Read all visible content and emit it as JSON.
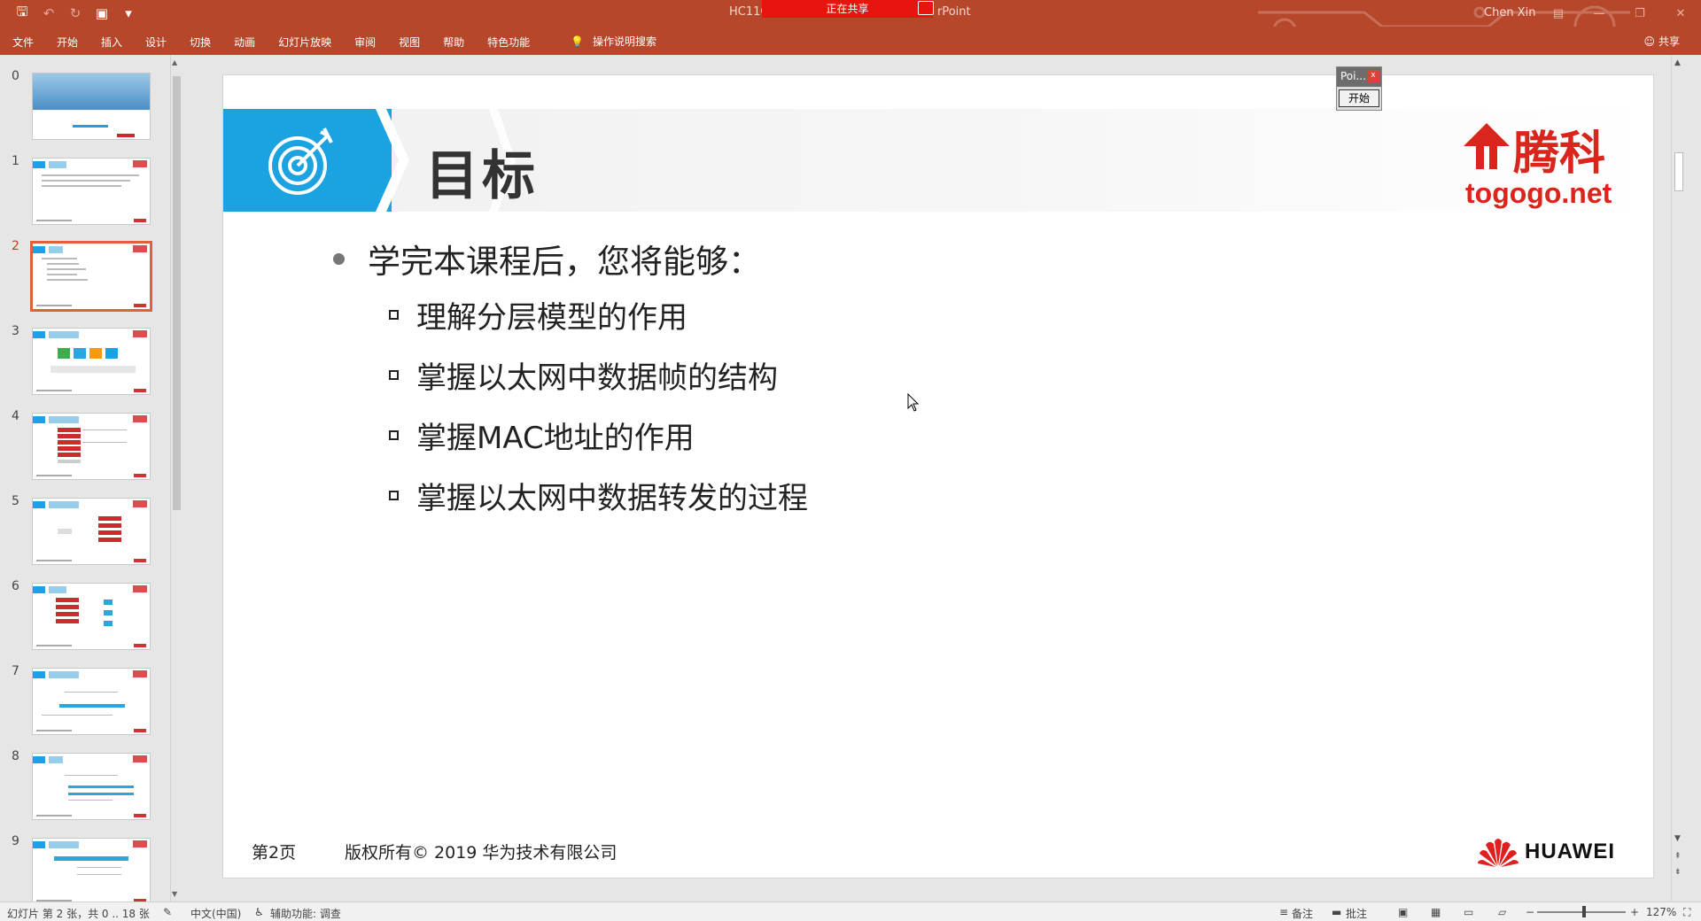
{
  "window": {
    "title_left": "HC11C",
    "title_right": "rPoint",
    "share_banner": "正在共享",
    "user": "Chen Xin"
  },
  "ribbon": {
    "tabs": [
      "文件",
      "开始",
      "插入",
      "设计",
      "切换",
      "动画",
      "幻灯片放映",
      "审阅",
      "视图",
      "帮助",
      "特色功能"
    ],
    "tell_me": "操作说明搜索",
    "share": "共享"
  },
  "thumbnails": {
    "numbers": [
      "0",
      "1",
      "2",
      "3",
      "4",
      "5",
      "6",
      "7",
      "8",
      "9"
    ],
    "active_index": 2
  },
  "slide": {
    "title": "目标",
    "logo_brand": "腾科",
    "logo_url": "togogo.net",
    "bullet": "学完本课程后，您将能够：",
    "sub_bullets": [
      "理解分层模型的作用",
      "掌握以太网中数据帧的结构",
      "掌握MAC地址的作用",
      "掌握以太网中数据转发的过程"
    ],
    "footer_page": "第2页",
    "footer_copyright": "版权所有© 2019 华为技术有限公司",
    "huawei": "HUAWEI"
  },
  "pointer_window": {
    "title": "Poi...",
    "close": "x",
    "start": "开始"
  },
  "statusbar": {
    "slide_info": "幻灯片 第 2 张，共 0 .. 18 张",
    "language": "中文(中国)",
    "accessibility": "辅助功能: 调查",
    "notes": "备注",
    "comments": "批注",
    "zoom": "127%"
  },
  "colors": {
    "ribbon": "#b7472a",
    "accent_blue": "#1aa3e0",
    "brand_red": "#d9251c"
  }
}
